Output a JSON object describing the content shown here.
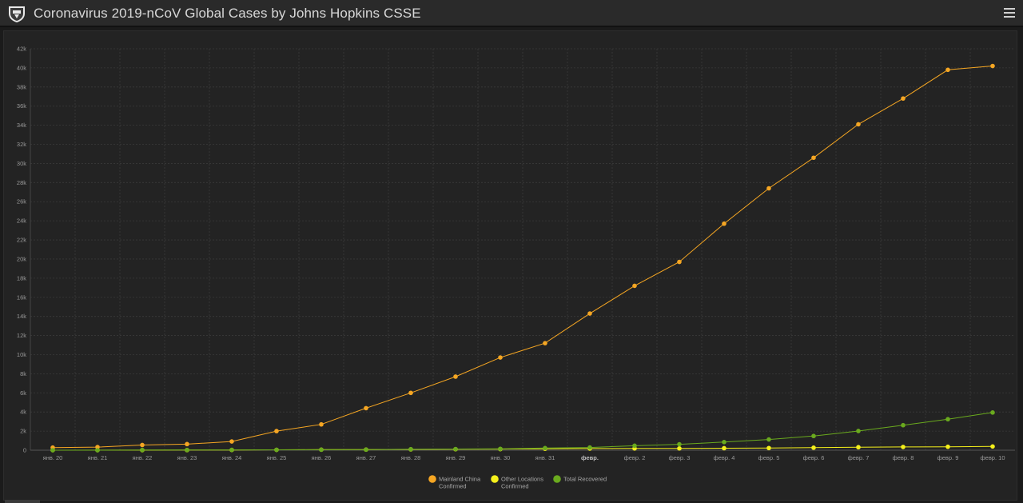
{
  "header": {
    "title": "Coronavirus 2019-nCoV Global Cases by Johns Hopkins CSSE",
    "logo_icon": "jhu-shield-icon",
    "menu_icon": "hamburger-menu-icon"
  },
  "chart_data": {
    "type": "line",
    "x": [
      "янв. 20",
      "янв. 21",
      "янв. 22",
      "янв. 23",
      "янв. 24",
      "янв. 25",
      "янв. 26",
      "янв. 27",
      "янв. 28",
      "янв. 29",
      "янв. 30",
      "янв. 31",
      "февр.",
      "февр. 2",
      "февр. 3",
      "февр. 4",
      "февр. 5",
      "февр. 6",
      "февр. 7",
      "февр. 8",
      "февр. 9",
      "февр. 10"
    ],
    "bold_ticks": [
      "февр."
    ],
    "yticks": [
      "0",
      "2k",
      "4k",
      "6k",
      "8k",
      "10k",
      "12k",
      "14k",
      "16k",
      "18k",
      "20k",
      "22k",
      "24k",
      "26k",
      "28k",
      "30k",
      "32k",
      "34k",
      "36k",
      "38k",
      "40k",
      "42k"
    ],
    "ylim": [
      0,
      42000
    ],
    "grid": true,
    "legend_position": "bottom-center",
    "series": [
      {
        "name": "Mainland China Confirmed",
        "legend_lines": [
          "Mainland China",
          "Confirmed"
        ],
        "color": "#f5a623",
        "values": [
          278,
          326,
          547,
          639,
          916,
          2000,
          2700,
          4400,
          6000,
          7700,
          9700,
          11200,
          14300,
          17200,
          19700,
          23700,
          27400,
          30600,
          34100,
          36800,
          39800,
          40200
        ]
      },
      {
        "name": "Other Locations Confirmed",
        "legend_lines": [
          "Other Locations",
          "Confirmed"
        ],
        "color": "#f5f01b",
        "values": [
          4,
          6,
          8,
          14,
          25,
          40,
          57,
          64,
          87,
          105,
          118,
          153,
          173,
          183,
          188,
          212,
          227,
          265,
          317,
          343,
          361,
          393
        ]
      },
      {
        "name": "Total Recovered",
        "legend_lines": [
          "Total Recovered"
        ],
        "color": "#6aaa1e",
        "values": [
          0,
          0,
          28,
          30,
          36,
          39,
          52,
          61,
          107,
          126,
          143,
          222,
          284,
          472,
          623,
          852,
          1124,
          1487,
          2011,
          2616,
          3244,
          3946
        ]
      }
    ]
  }
}
